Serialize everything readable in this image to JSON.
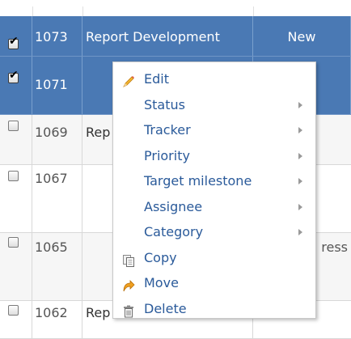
{
  "issues": [
    {
      "id": "1073",
      "subject": "Report Development",
      "status": "New",
      "checked": true,
      "selected": true
    },
    {
      "id": "1071",
      "subject": "",
      "status": "",
      "checked": true,
      "selected": true
    },
    {
      "id": "1069",
      "subject": "Rep",
      "status": "",
      "checked": false,
      "selected": false
    },
    {
      "id": "1067",
      "subject": "",
      "status": "",
      "checked": false,
      "selected": false
    },
    {
      "id": "1065",
      "subject": "",
      "status": "ress",
      "checked": false,
      "selected": false
    },
    {
      "id": "1062",
      "subject": "Rep",
      "status": "",
      "checked": false,
      "selected": false
    }
  ],
  "context_menu": {
    "items": [
      {
        "label": "Edit",
        "icon": "pencil-icon",
        "submenu": false
      },
      {
        "label": "Status",
        "icon": "",
        "submenu": true
      },
      {
        "label": "Tracker",
        "icon": "",
        "submenu": true
      },
      {
        "label": "Priority",
        "icon": "",
        "submenu": true
      },
      {
        "label": "Target milestone",
        "icon": "",
        "submenu": true
      },
      {
        "label": "Assignee",
        "icon": "",
        "submenu": true
      },
      {
        "label": "Category",
        "icon": "",
        "submenu": true
      },
      {
        "label": "Copy",
        "icon": "copy-icon",
        "submenu": false
      },
      {
        "label": "Move",
        "icon": "move-arrow-icon",
        "submenu": false
      },
      {
        "label": "Delete",
        "icon": "trash-icon",
        "submenu": false
      }
    ]
  },
  "colors": {
    "selected_row": "#4a79b4",
    "menu_text": "#2a5a9a"
  }
}
